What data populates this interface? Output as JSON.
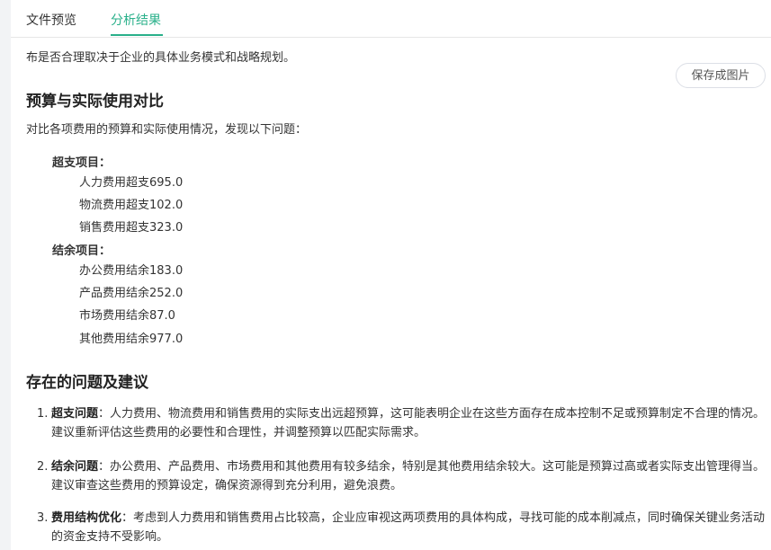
{
  "tabs": [
    {
      "label": "文件预览"
    },
    {
      "label": "分析结果",
      "active": true
    }
  ],
  "accent_color": "#29b08a",
  "save_button": "保存成图片",
  "intro_line": "布是否合理取决于企业的具体业务模式和战略规划。",
  "budget_section": {
    "heading": "预算与实际使用对比",
    "intro": "对比各项费用的预算和实际使用情况，发现以下问题：",
    "overspend": {
      "label": "超支项目：",
      "items": [
        "人力费用超支695.0",
        "物流费用超支102.0",
        "销售费用超支323.0"
      ]
    },
    "surplus": {
      "label": "结余项目：",
      "items": [
        "办公费用结余183.0",
        "产品费用结余252.0",
        "市场费用结余87.0",
        "其他费用结余977.0"
      ]
    }
  },
  "issues_section": {
    "heading": "存在的问题及建议",
    "items": [
      {
        "num": "1.",
        "title": "超支问题",
        "text": "：人力费用、物流费用和销售费用的实际支出远超预算，这可能表明企业在这些方面存在成本控制不足或预算制定不合理的情况。建议重新评估这些费用的必要性和合理性，并调整预算以匹配实际需求。"
      },
      {
        "num": "2.",
        "title": "结余问题",
        "text": "：办公费用、产品费用、市场费用和其他费用有较多结余，特别是其他费用结余较大。这可能是预算过高或者实际支出管理得当。建议审查这些费用的预算设定，确保资源得到充分利用，避免浪费。"
      },
      {
        "num": "3.",
        "title": "费用结构优化",
        "text": "：考虑到人力费用和销售费用占比较高，企业应审视这两项费用的具体构成，寻找可能的成本削减点，同时确保关键业务活动的资金支持不受影响。"
      }
    ]
  }
}
